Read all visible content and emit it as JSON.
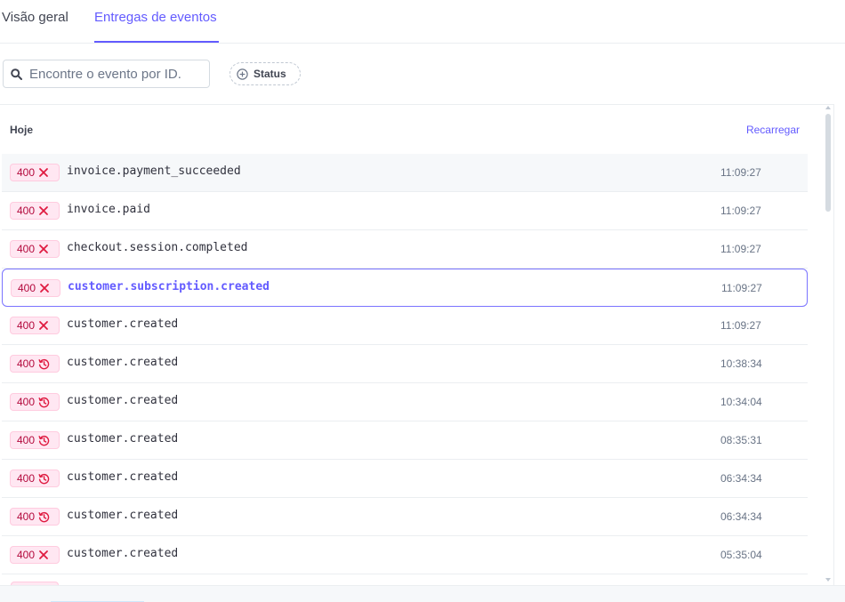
{
  "tabs": [
    {
      "label": "Visão geral"
    },
    {
      "label": "Entregas de eventos"
    }
  ],
  "search": {
    "placeholder": "Encontre o evento por ID."
  },
  "filter": {
    "status_label": "Status"
  },
  "list": {
    "day_label": "Hoje",
    "reload_label": "Recarregar",
    "events": [
      {
        "code": "400",
        "icon": "x-icon",
        "name": "invoice.payment_succeeded",
        "time": "11:09:27"
      },
      {
        "code": "400",
        "icon": "x-icon",
        "name": "invoice.paid",
        "time": "11:09:27"
      },
      {
        "code": "400",
        "icon": "x-icon",
        "name": "checkout.session.completed",
        "time": "11:09:27"
      },
      {
        "code": "400",
        "icon": "x-icon",
        "name": "customer.subscription.created",
        "time": "11:09:27"
      },
      {
        "code": "400",
        "icon": "x-icon",
        "name": "customer.created",
        "time": "11:09:27"
      },
      {
        "code": "400",
        "icon": "retry-clock-icon",
        "name": "customer.created",
        "time": "10:38:34"
      },
      {
        "code": "400",
        "icon": "retry-clock-icon",
        "name": "customer.created",
        "time": "10:34:04"
      },
      {
        "code": "400",
        "icon": "retry-clock-icon",
        "name": "customer.created",
        "time": "08:35:31"
      },
      {
        "code": "400",
        "icon": "retry-clock-icon",
        "name": "customer.created",
        "time": "06:34:34"
      },
      {
        "code": "400",
        "icon": "retry-clock-icon",
        "name": "customer.created",
        "time": "06:34:34"
      },
      {
        "code": "400",
        "icon": "x-icon",
        "name": "customer.created",
        "time": "05:35:04"
      }
    ]
  },
  "colors": {
    "accent": "#635bff",
    "error_text": "#b3093c",
    "error_bg": "#ffe7f2"
  }
}
